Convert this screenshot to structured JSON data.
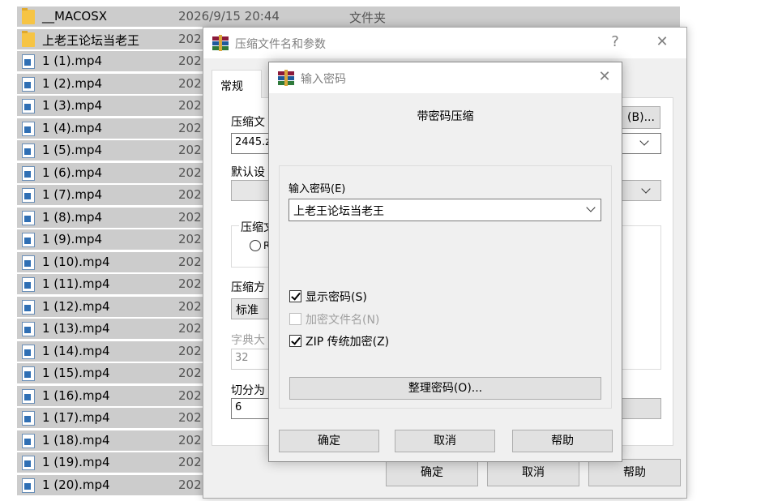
{
  "files": [
    {
      "name": "__MACOSX",
      "date": "2026/9/15 20:44",
      "type": "文件夹",
      "icon": "folder-icon"
    },
    {
      "name": "上老王论坛当老王",
      "date": "202",
      "type": "",
      "icon": "folder-icon"
    },
    {
      "name": "1 (1).mp4",
      "date": "202",
      "type": "",
      "icon": "video-file-icon"
    },
    {
      "name": "1 (2).mp4",
      "date": "202",
      "type": "",
      "icon": "video-file-icon"
    },
    {
      "name": "1 (3).mp4",
      "date": "202",
      "type": "",
      "icon": "video-file-icon"
    },
    {
      "name": "1 (4).mp4",
      "date": "202",
      "type": "",
      "icon": "video-file-icon"
    },
    {
      "name": "1 (5).mp4",
      "date": "202",
      "type": "",
      "icon": "video-file-icon"
    },
    {
      "name": "1 (6).mp4",
      "date": "202",
      "type": "",
      "icon": "video-file-icon"
    },
    {
      "name": "1 (7).mp4",
      "date": "202",
      "type": "",
      "icon": "video-file-icon"
    },
    {
      "name": "1 (8).mp4",
      "date": "202",
      "type": "",
      "icon": "video-file-icon"
    },
    {
      "name": "1 (9).mp4",
      "date": "202",
      "type": "",
      "icon": "video-file-icon"
    },
    {
      "name": "1 (10).mp4",
      "date": "202",
      "type": "",
      "icon": "video-file-icon"
    },
    {
      "name": "1 (11).mp4",
      "date": "202",
      "type": "",
      "icon": "video-file-icon"
    },
    {
      "name": "1 (12).mp4",
      "date": "202",
      "type": "",
      "icon": "video-file-icon"
    },
    {
      "name": "1 (13).mp4",
      "date": "202",
      "type": "",
      "icon": "video-file-icon"
    },
    {
      "name": "1 (14).mp4",
      "date": "202",
      "type": "",
      "icon": "video-file-icon"
    },
    {
      "name": "1 (15).mp4",
      "date": "202",
      "type": "",
      "icon": "video-file-icon"
    },
    {
      "name": "1 (16).mp4",
      "date": "202",
      "type": "",
      "icon": "video-file-icon"
    },
    {
      "name": "1 (17).mp4",
      "date": "202",
      "type": "",
      "icon": "video-file-icon"
    },
    {
      "name": "1 (18).mp4",
      "date": "202",
      "type": "",
      "icon": "video-file-icon"
    },
    {
      "name": "1 (19).mp4",
      "date": "202",
      "type": "",
      "icon": "video-file-icon"
    },
    {
      "name": "1 (20).mp4",
      "date": "202",
      "type": "",
      "icon": "video-file-icon"
    }
  ],
  "archive_dialog": {
    "title": "压缩文件名和参数",
    "help_glyph": "?",
    "close_glyph": "✕",
    "tab_general": "常规",
    "archive_name_label": "压缩文",
    "archive_name_value": "2445.z",
    "browse_button": "(B)...",
    "default_profile_label": "默认设",
    "format_group_label": "压缩文",
    "format_radio_label": "R",
    "method_label": "压缩方",
    "method_value": "标准",
    "dict_label": "字典大",
    "dict_value": "32",
    "split_label": "切分为",
    "split_value": "6",
    "ok_button": "确定",
    "cancel_button": "取消",
    "help_button": "帮助"
  },
  "password_dialog": {
    "title": "输入密码",
    "close_glyph": "✕",
    "heading": "带密码压缩",
    "password_label": "输入密码(E)",
    "password_value": "上老王论坛当老王",
    "show_password": {
      "label": "显示密码(S)",
      "checked": true,
      "enabled": true
    },
    "encrypt_names": {
      "label": "加密文件名(N)",
      "checked": false,
      "enabled": false
    },
    "zip_legacy": {
      "label": "ZIP 传统加密(Z)",
      "checked": true,
      "enabled": true
    },
    "organize_button": "整理密码(O)...",
    "ok_button": "确定",
    "cancel_button": "取消",
    "help_button": "帮助"
  },
  "colors": {
    "file_row_bg": "#cccccc",
    "dialog_bg": "#f0f0f0",
    "button_bg": "#e1e1e1",
    "folder": "#f6c444"
  }
}
